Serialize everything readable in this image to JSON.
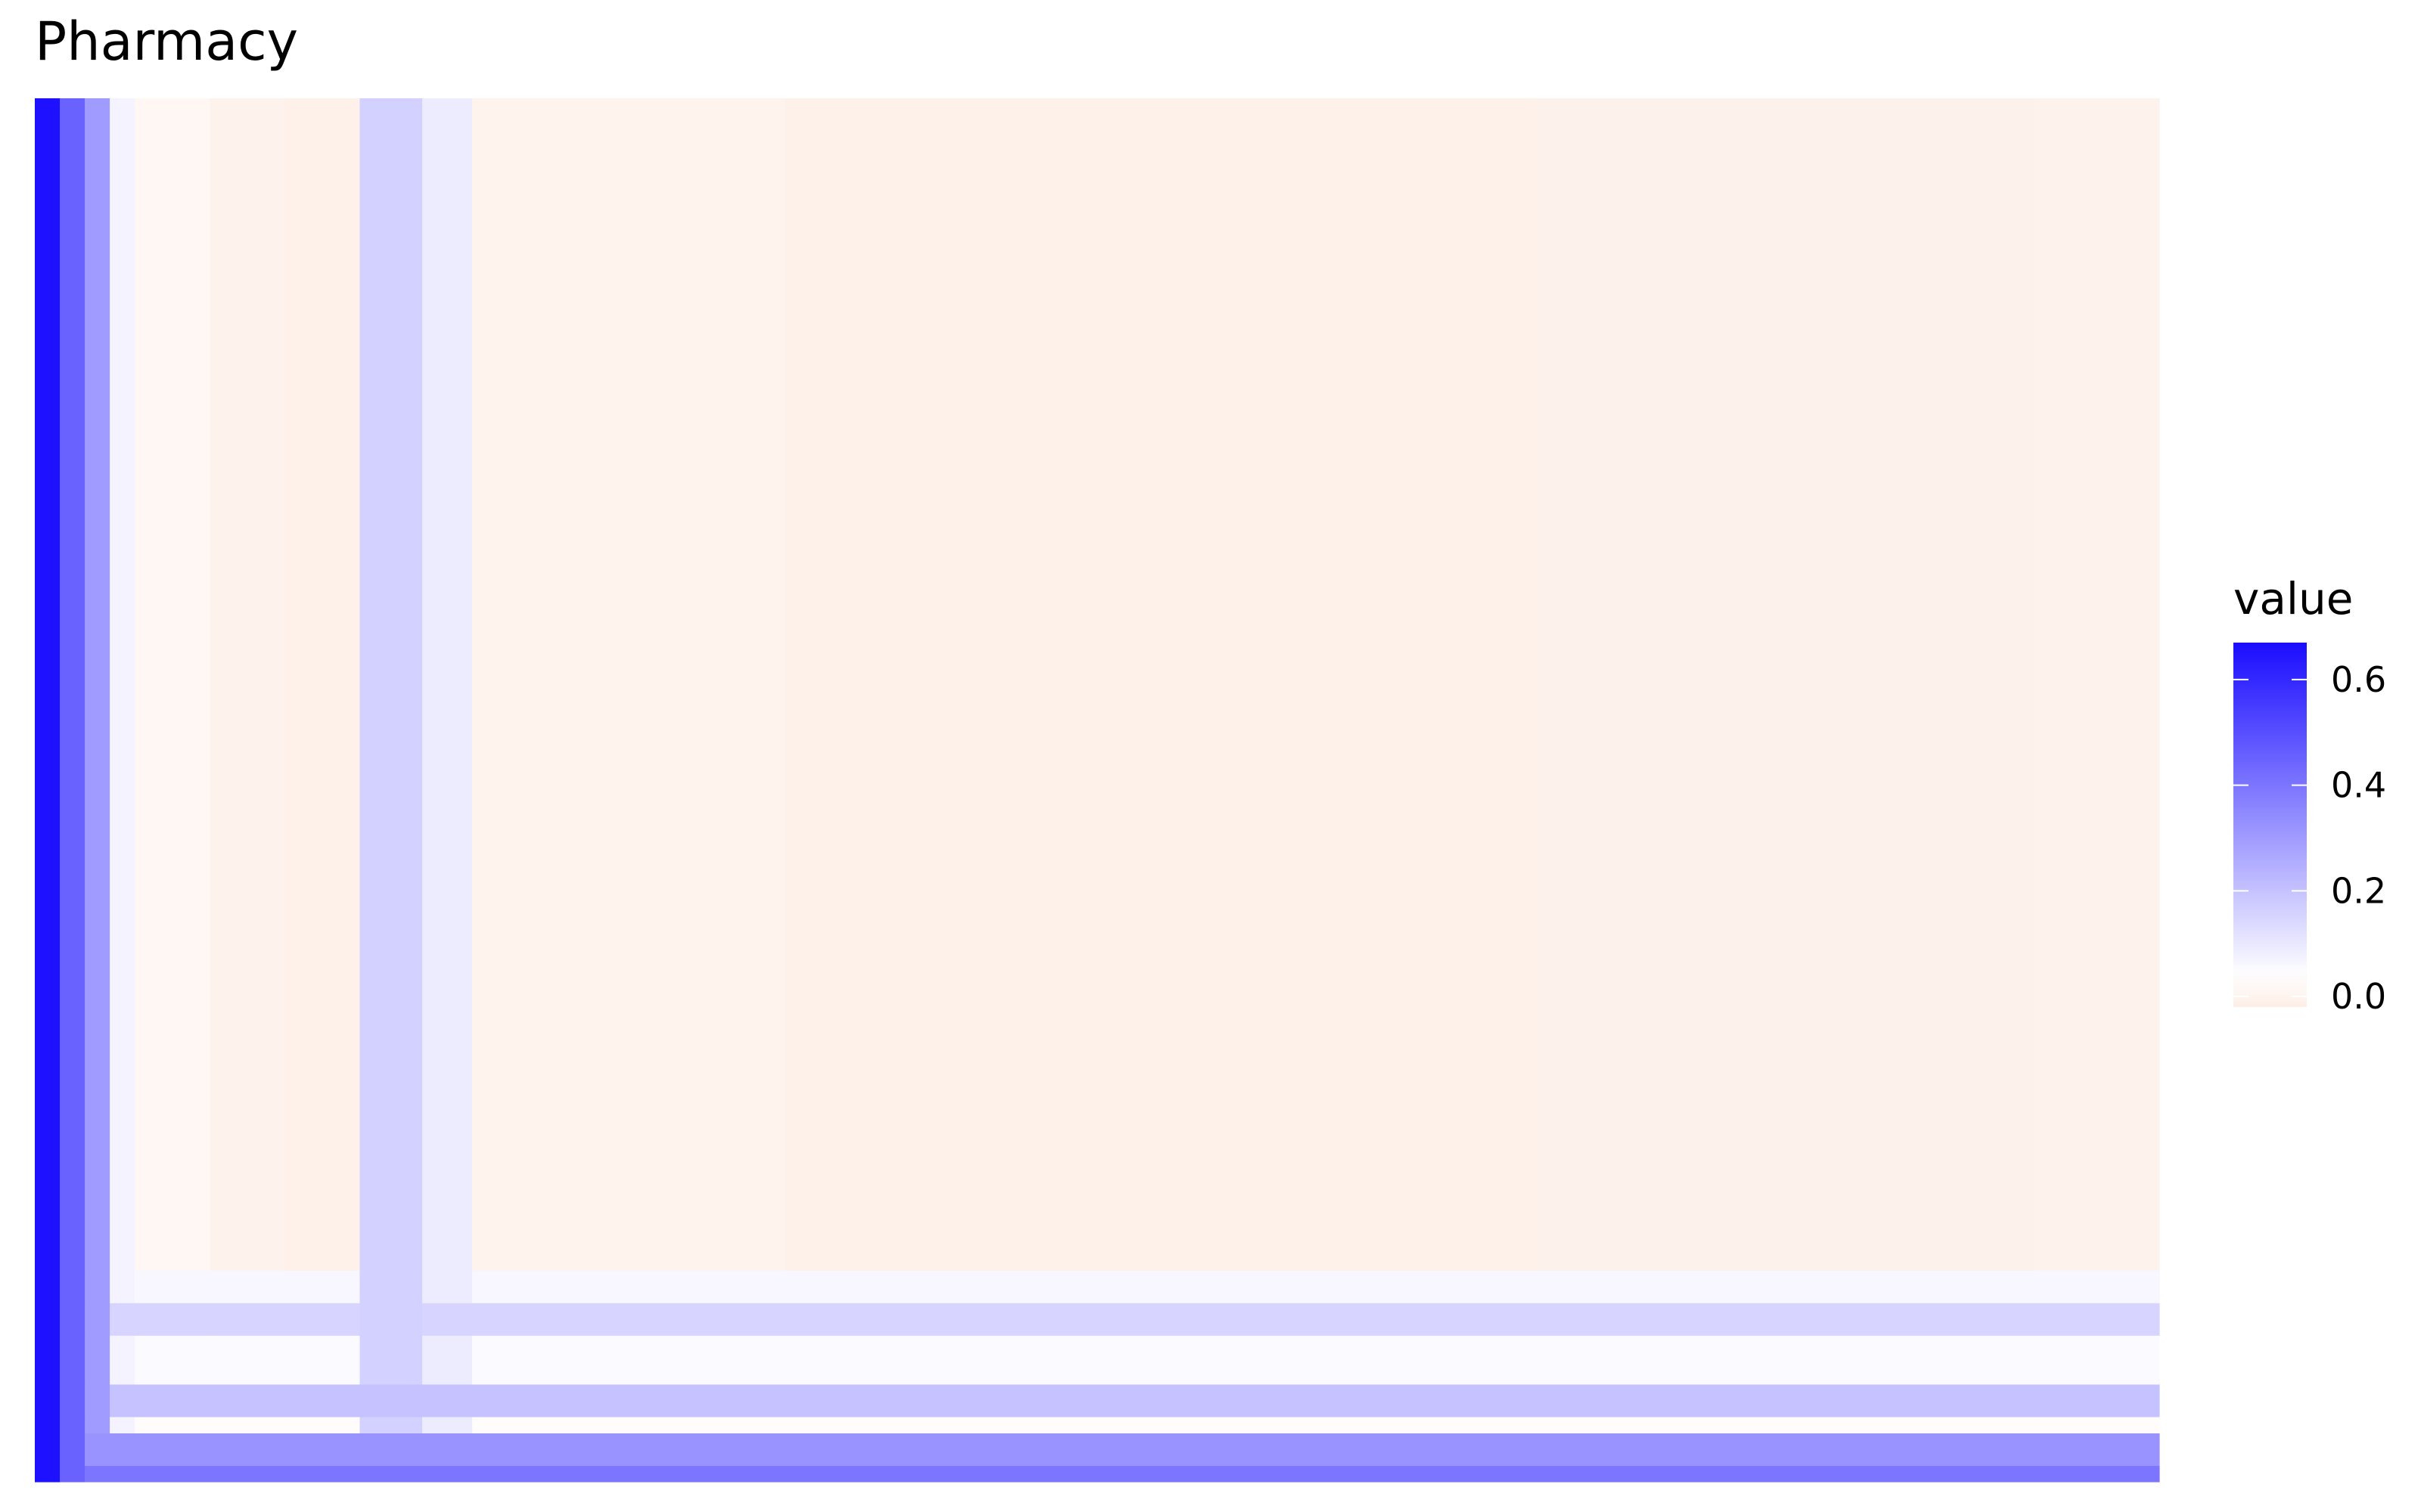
{
  "chart_data": {
    "type": "heatmap",
    "title": "Pharmacy",
    "xlabel": "",
    "ylabel": "",
    "grid": false,
    "legend": {
      "title": "value",
      "position": "right",
      "ticks": [
        0.0,
        0.2,
        0.4,
        0.6
      ],
      "tick_labels": [
        "0.0",
        "0.2",
        "0.4",
        "0.6"
      ],
      "range": [
        -0.02,
        0.67
      ],
      "low_color": "#fdeee6",
      "mid_color": "#ffffff",
      "high_color": "#1a0dff",
      "midpoint": 0.04
    },
    "matrix_size": [
      170,
      170
    ],
    "column_band_values": [
      {
        "from": 0,
        "to": 2,
        "value": 0.66
      },
      {
        "from": 2,
        "to": 4,
        "value": 0.45
      },
      {
        "from": 4,
        "to": 6,
        "value": 0.3
      },
      {
        "from": 6,
        "to": 8,
        "value": 0.07
      },
      {
        "from": 8,
        "to": 14,
        "value": 0.01
      },
      {
        "from": 14,
        "to": 20,
        "value": -0.005
      },
      {
        "from": 20,
        "to": 26,
        "value": -0.012
      },
      {
        "from": 26,
        "to": 31,
        "value": 0.16
      },
      {
        "from": 31,
        "to": 35,
        "value": 0.09
      },
      {
        "from": 35,
        "to": 60,
        "value": -0.004
      },
      {
        "from": 60,
        "to": 120,
        "value": -0.01
      },
      {
        "from": 120,
        "to": 160,
        "value": -0.008
      },
      {
        "from": 160,
        "to": 170,
        "value": -0.006
      }
    ],
    "row_band_values": [
      {
        "from": 0,
        "to": 2,
        "value": 0.4
      },
      {
        "from": 2,
        "to": 6,
        "value": 0.32
      },
      {
        "from": 6,
        "to": 8,
        "value": 0.03
      },
      {
        "from": 8,
        "to": 12,
        "value": 0.2
      },
      {
        "from": 12,
        "to": 18,
        "value": 0.05
      },
      {
        "from": 18,
        "to": 22,
        "value": 0.15
      },
      {
        "from": 22,
        "to": 26,
        "value": 0.06
      },
      {
        "from": 26,
        "to": 170,
        "value": -0.01
      }
    ]
  }
}
